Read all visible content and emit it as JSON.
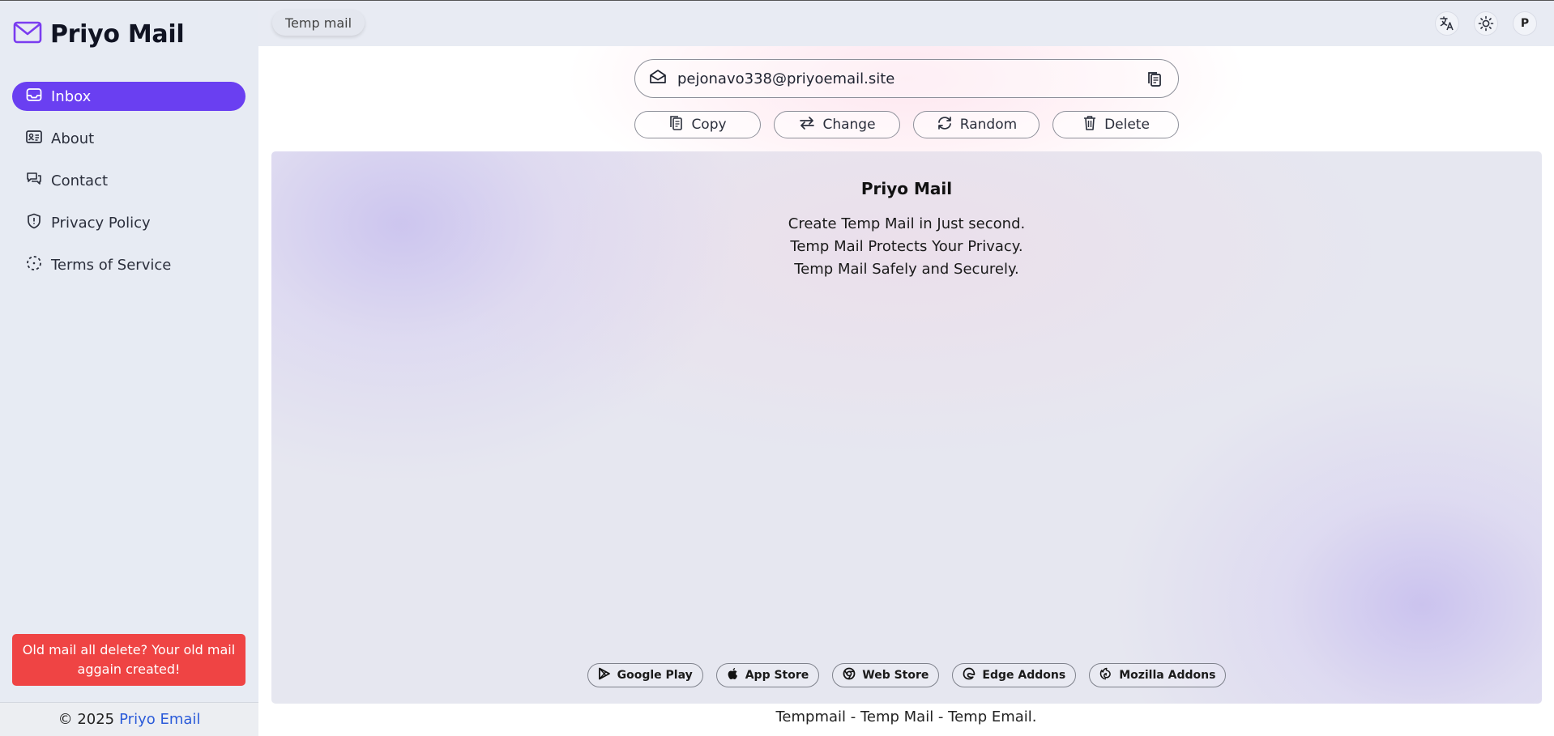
{
  "brand": {
    "title": "Priyo Mail",
    "accent": "#6a3ff1"
  },
  "sidebar": {
    "items": [
      {
        "label": "Inbox",
        "icon": "inbox-icon",
        "active": true
      },
      {
        "label": "About",
        "icon": "id-card-icon",
        "active": false
      },
      {
        "label": "Contact",
        "icon": "chat-icon",
        "active": false
      },
      {
        "label": "Privacy Policy",
        "icon": "shield-icon",
        "active": false
      },
      {
        "label": "Terms of Service",
        "icon": "dashed-circle-icon",
        "active": false
      }
    ],
    "alert": "Old mail all delete? Your old mail aggain created!",
    "footer": {
      "copyright": "© 2025",
      "link": "Priyo Email"
    }
  },
  "topbar": {
    "tab": "Temp mail",
    "avatar_initial": "P",
    "icons": [
      "translate-icon",
      "sun-icon"
    ]
  },
  "email": {
    "address": "pejonavo338@priyoemail.site",
    "actions": [
      "Copy",
      "Change",
      "Random",
      "Delete"
    ]
  },
  "content": {
    "title": "Priyo Mail",
    "lines": [
      "Create Temp Mail in Just second.",
      "Temp Mail Protects Your Privacy.",
      "Temp Mail Safely and Securely."
    ],
    "stores": [
      "Google Play",
      "App Store",
      "Web Store",
      "Edge Addons",
      "Mozilla Addons"
    ]
  },
  "footer": {
    "text": "Tempmail - Temp Mail - Temp Email."
  },
  "colors": {
    "alert": "#ef4444",
    "link": "#2b5bd9"
  }
}
